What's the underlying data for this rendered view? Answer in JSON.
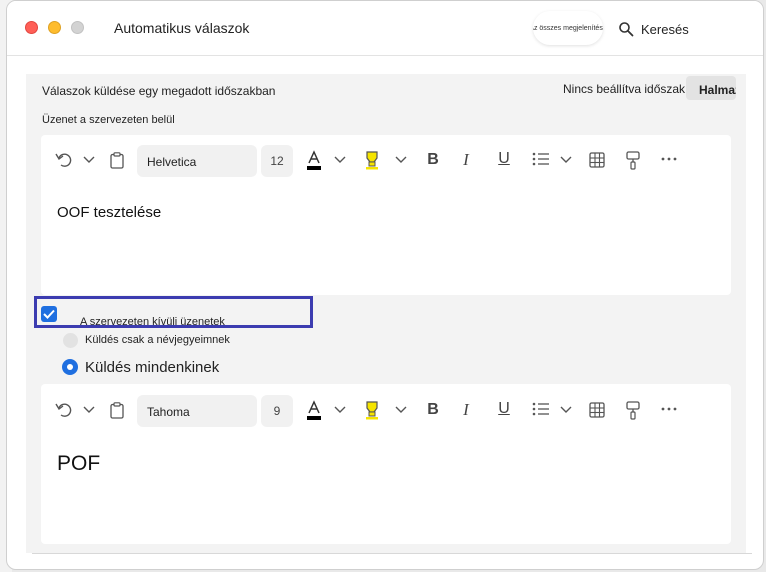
{
  "window": {
    "title": "Automatikus válaszok",
    "show_all_label": "Az összes megjelenítése",
    "search_label": "Keresés"
  },
  "schedule": {
    "label": "Válaszok küldése egy megadott időszakban",
    "status": "Nincs beállítva időszak",
    "set_button": "Halmaz:"
  },
  "internal": {
    "label": "Üzenet a szervezeten belül",
    "font": "Helvetica",
    "size": "12",
    "body": "OOF tesztelése"
  },
  "external": {
    "checkbox_label": "A szervezeten kívüli üzenetek",
    "checked": true,
    "option_contacts": "Küldés csak a névjegyeimnek",
    "option_all": "Küldés mindenkinek",
    "selected_option": "Küldés mindenkinek",
    "font": "Tahoma",
    "size": "9",
    "body": "POF"
  },
  "toolbar_icons": [
    "undo-icon",
    "chevron-down-icon",
    "clipboard-icon",
    "font-color-icon",
    "highlight-icon",
    "bold-icon",
    "italic-icon",
    "underline-icon",
    "bullet-list-icon",
    "table-icon",
    "format-painter-icon",
    "more-icon"
  ],
  "colors": {
    "accent": "#1f6fe0",
    "highlight_frame": "#3c3cb0",
    "font_color_bar": "#000000",
    "highlighter_yellow": "#f5e400"
  }
}
